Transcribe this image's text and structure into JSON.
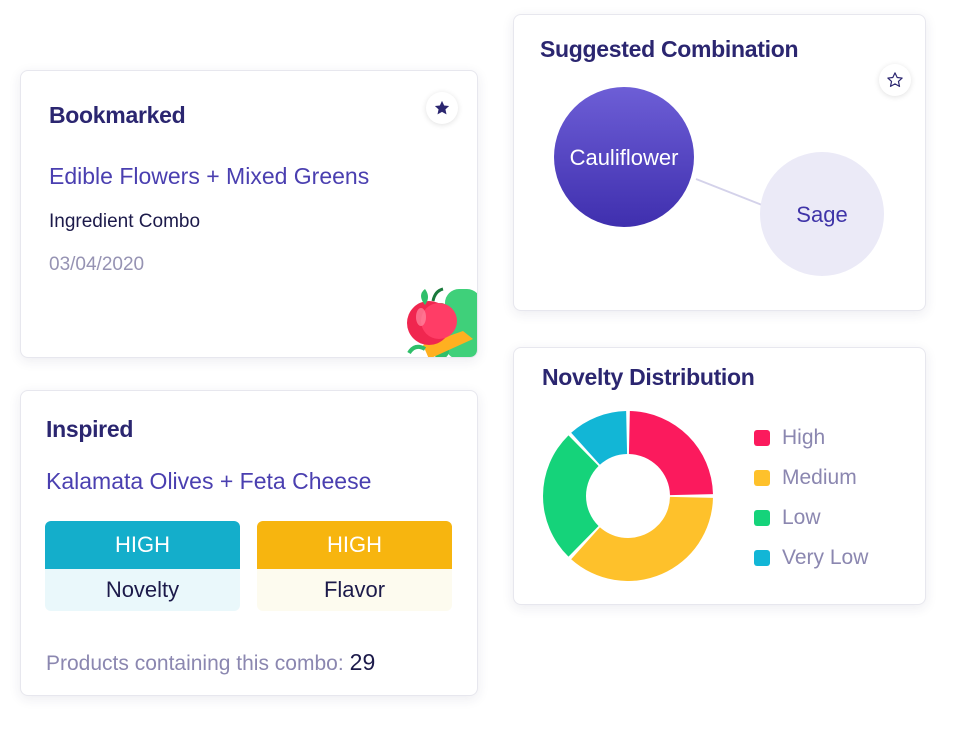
{
  "bookmarked": {
    "title": "Bookmarked",
    "combo": "Edible Flowers + Mixed Greens",
    "type": "Ingredient Combo",
    "date": "03/04/2020",
    "star_icon": "star-filled-icon"
  },
  "inspired": {
    "title": "Inspired",
    "combo": "Kalamata Olives + Feta Cheese",
    "metrics": [
      {
        "level": "HIGH",
        "name": "Novelty",
        "color": "#14aecb"
      },
      {
        "level": "HIGH",
        "name": "Flavor",
        "color": "#f7b50f"
      }
    ],
    "products_label": "Products containing this combo:",
    "products_count": "29"
  },
  "suggested": {
    "title": "Suggested Combination",
    "star_icon": "star-outline-icon",
    "nodes": [
      {
        "label": "Cauliflower"
      },
      {
        "label": "Sage"
      }
    ]
  },
  "novelty": {
    "title": "Novelty Distribution",
    "legend": [
      {
        "label": "High",
        "color": "#fb1a5d"
      },
      {
        "label": "Medium",
        "color": "#fec12b"
      },
      {
        "label": "Low",
        "color": "#15d37a"
      },
      {
        "label": "Very Low",
        "color": "#12b6d6"
      }
    ]
  },
  "chart_data": {
    "type": "pie",
    "title": "Novelty Distribution",
    "categories": [
      "High",
      "Medium",
      "Low",
      "Very Low"
    ],
    "values": [
      25,
      37,
      26,
      12
    ],
    "colors": [
      "#fb1a5d",
      "#fec12b",
      "#15d37a",
      "#12b6d6"
    ]
  }
}
